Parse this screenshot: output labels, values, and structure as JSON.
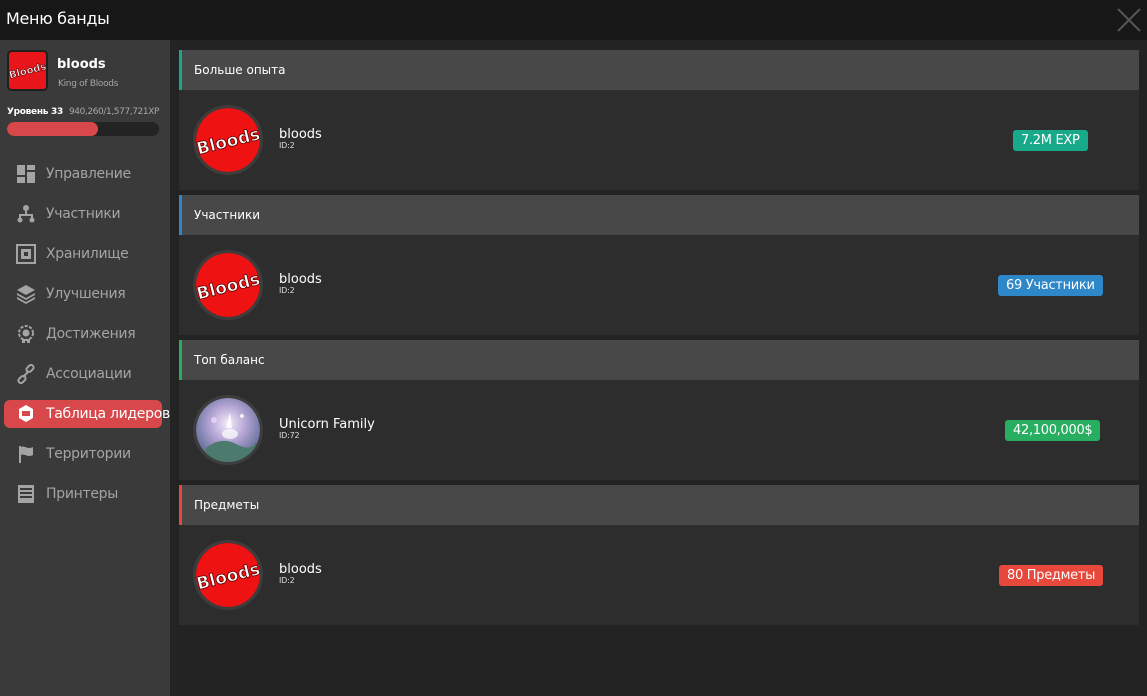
{
  "window": {
    "title": "Меню банды",
    "close_icon": "close-icon"
  },
  "gang": {
    "name": "bloods",
    "subtitle": "King of Bloods",
    "logo_text": "Bloods",
    "level_label": "Уровень 33",
    "xp_text": "940,260/1,577,721XP",
    "xp_progress": 0.596
  },
  "nav": {
    "items": [
      {
        "label": "Управление",
        "icon": "dashboard-icon",
        "active": false
      },
      {
        "label": "Участники",
        "icon": "hierarchy-icon",
        "active": false
      },
      {
        "label": "Хранилище",
        "icon": "storage-icon",
        "active": false
      },
      {
        "label": "Улучшения",
        "icon": "layers-icon",
        "active": false
      },
      {
        "label": "Достижения",
        "icon": "medal-icon",
        "active": false
      },
      {
        "label": "Ассоциации",
        "icon": "link-icon",
        "active": false
      },
      {
        "label": "Таблица лидеров",
        "icon": "leaderboard-icon",
        "active": true
      },
      {
        "label": "Территории",
        "icon": "flag-icon",
        "active": false
      },
      {
        "label": "Принтеры",
        "icon": "printer-icon",
        "active": false
      }
    ]
  },
  "colors": {
    "accent_red": "#d8484a",
    "teal": "#18a88a",
    "blue": "#2e87c8",
    "green": "#27ae60",
    "red": "#e8473c"
  },
  "leaderboard": {
    "sections": [
      {
        "header": "Больше опыта",
        "accent": "#18a88a",
        "entry": {
          "name": "bloods",
          "id": "ID:2",
          "avatar": "bloods-logo"
        },
        "badge": "7.2M EXP",
        "badge_color": "#18a88a"
      },
      {
        "header": "Участники",
        "accent": "#2e87c8",
        "entry": {
          "name": "bloods",
          "id": "ID:2",
          "avatar": "bloods-logo"
        },
        "badge": "69 Участники",
        "badge_color": "#2e87c8"
      },
      {
        "header": "Топ баланс",
        "accent": "#27ae60",
        "entry": {
          "name": "Unicorn Family",
          "id": "ID:72",
          "avatar": "unicorn-image"
        },
        "badge": "42,100,000$",
        "badge_color": "#27ae60"
      },
      {
        "header": "Предметы",
        "accent": "#e8473c",
        "entry": {
          "name": "bloods",
          "id": "ID:2",
          "avatar": "bloods-logo"
        },
        "badge": "80 Предметы",
        "badge_color": "#e8473c"
      }
    ]
  }
}
